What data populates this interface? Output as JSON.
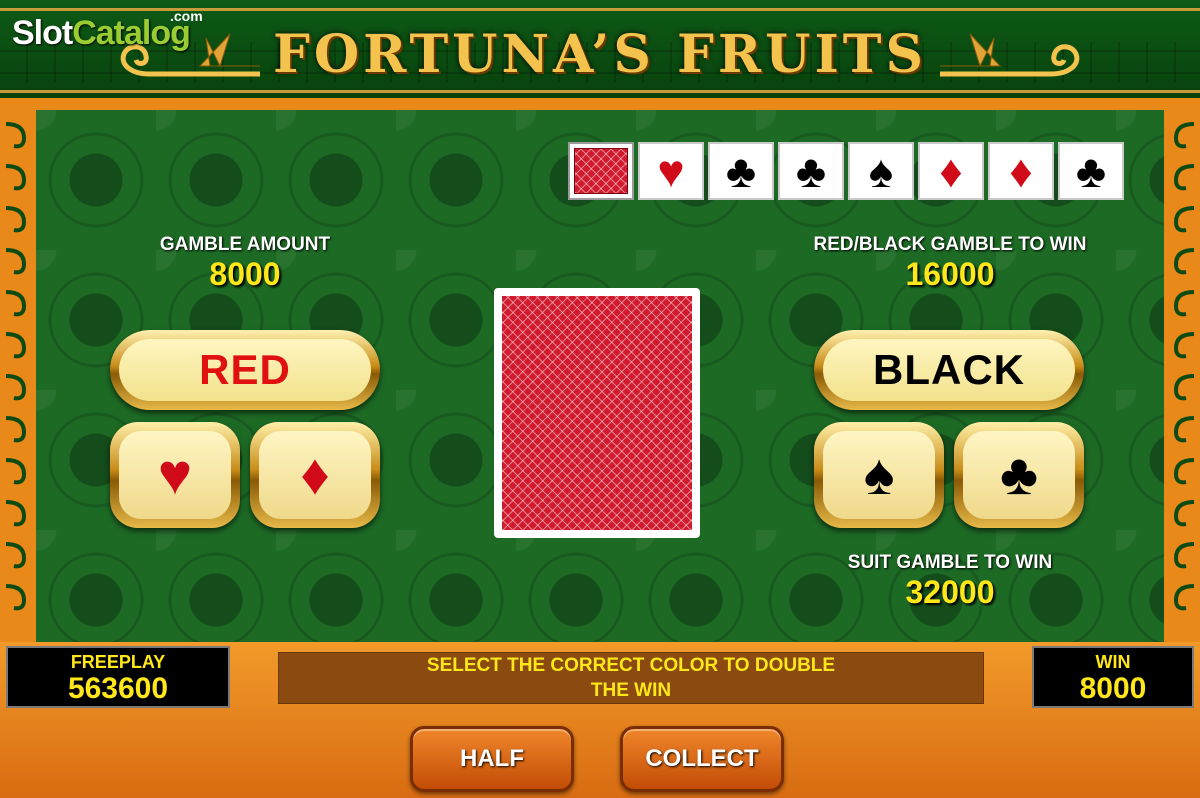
{
  "watermark": {
    "slot": "Slot",
    "catalog": "Catalog",
    "com": ".com"
  },
  "game": {
    "title": "FORTUNA’S FRUITS"
  },
  "history": [
    {
      "type": "back"
    },
    {
      "type": "suit",
      "suit": "heart",
      "glyph": "♥",
      "color": "red"
    },
    {
      "type": "suit",
      "suit": "club",
      "glyph": "♣",
      "color": "black"
    },
    {
      "type": "suit",
      "suit": "club",
      "glyph": "♣",
      "color": "black"
    },
    {
      "type": "suit",
      "suit": "spade",
      "glyph": "♠",
      "color": "black"
    },
    {
      "type": "suit",
      "suit": "diamond",
      "glyph": "♦",
      "color": "red"
    },
    {
      "type": "suit",
      "suit": "diamond",
      "glyph": "♦",
      "color": "red"
    },
    {
      "type": "suit",
      "suit": "club",
      "glyph": "♣",
      "color": "black"
    }
  ],
  "gamble": {
    "amount_label": "GAMBLE AMOUNT",
    "amount_value": "8000",
    "color_label": "RED/BLACK GAMBLE TO WIN",
    "color_value": "16000",
    "suit_label": "SUIT GAMBLE TO WIN",
    "suit_value": "32000"
  },
  "buttons": {
    "red": "RED",
    "black": "BLACK",
    "heart": "♥",
    "diamond": "♦",
    "spade": "♠",
    "club": "♣",
    "half": "HALF",
    "collect": "COLLECT"
  },
  "meters": {
    "freeplay_label": "FREEPLAY",
    "freeplay_value": "563600",
    "win_label": "WIN",
    "win_value": "8000"
  },
  "message": {
    "line1": "SELECT THE CORRECT COLOR TO DOUBLE",
    "line2": "THE WIN"
  },
  "colors": {
    "felt": "#1d6a25",
    "frame": "#e8891a",
    "value_yellow": "#ffe71a",
    "suit_red": "#d10a1a",
    "card_back": "#d21a2e"
  }
}
